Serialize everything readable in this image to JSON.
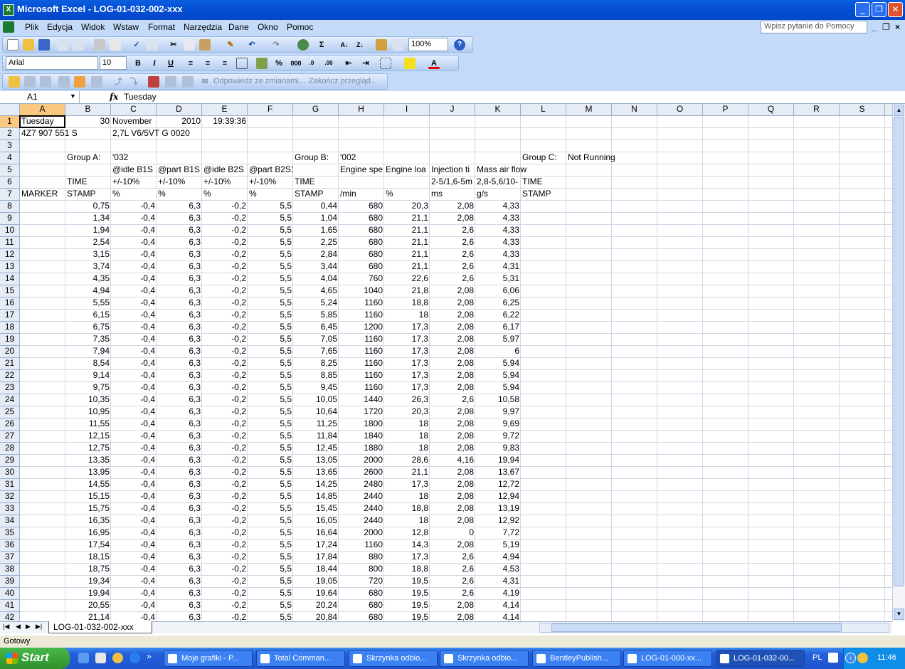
{
  "window": {
    "title": "Microsoft Excel - LOG-01-032-002-xxx",
    "app_icon": "excel-icon"
  },
  "menu": {
    "items": [
      "Plik",
      "Edycja",
      "Widok",
      "Wstaw",
      "Format",
      "Narzędzia",
      "Dane",
      "Okno",
      "Pomoc"
    ],
    "help_placeholder": "Wpisz pytanie do Pomocy"
  },
  "toolbar": {
    "zoom": "100%",
    "font": "Arial",
    "font_size": "10",
    "sigma": "Σ",
    "bold": "B",
    "italic": "I",
    "underline": "U",
    "percent": "%",
    "thousands": "000",
    "reply_label": "Odpowiedz ze zmianami...",
    "end_review_label": "Zakończ przegląd..."
  },
  "formula_bar": {
    "name_box": "A1",
    "fx": "fx",
    "content": "Tuesday"
  },
  "columns": [
    "A",
    "B",
    "C",
    "D",
    "E",
    "F",
    "G",
    "H",
    "I",
    "J",
    "K",
    "L",
    "M",
    "N",
    "O",
    "P",
    "Q",
    "R",
    "S"
  ],
  "header_cells": [
    {
      "r": 1,
      "c": 0,
      "v": "Tuesday"
    },
    {
      "r": 1,
      "c": 1,
      "v": "30",
      "n": true
    },
    {
      "r": 1,
      "c": 2,
      "v": "November"
    },
    {
      "r": 1,
      "c": 3,
      "v": "2010",
      "n": true
    },
    {
      "r": 1,
      "c": 4,
      "v": "19:39:36",
      "n": true
    },
    {
      "r": 2,
      "c": 0,
      "v": "4Z7 907 551 S"
    },
    {
      "r": 2,
      "c": 2,
      "v": "2,7L V6/5VT    G   0020"
    },
    {
      "r": 4,
      "c": 1,
      "v": "Group A:"
    },
    {
      "r": 4,
      "c": 2,
      "v": "'032"
    },
    {
      "r": 4,
      "c": 6,
      "v": "Group B:"
    },
    {
      "r": 4,
      "c": 7,
      "v": "'002"
    },
    {
      "r": 4,
      "c": 11,
      "v": "Group C:"
    },
    {
      "r": 4,
      "c": 12,
      "v": "Not Running"
    },
    {
      "r": 5,
      "c": 2,
      "v": "@idle B1S"
    },
    {
      "r": 5,
      "c": 3,
      "v": "@part B1S"
    },
    {
      "r": 5,
      "c": 4,
      "v": "@idle B2S"
    },
    {
      "r": 5,
      "c": 5,
      "v": "@part B2S1"
    },
    {
      "r": 5,
      "c": 7,
      "v": "Engine spe"
    },
    {
      "r": 5,
      "c": 8,
      "v": "Engine loa"
    },
    {
      "r": 5,
      "c": 9,
      "v": "Injection ti"
    },
    {
      "r": 5,
      "c": 10,
      "v": "Mass air flow"
    },
    {
      "r": 6,
      "c": 1,
      "v": "TIME"
    },
    {
      "r": 6,
      "c": 2,
      "v": "+/-10%"
    },
    {
      "r": 6,
      "c": 3,
      "v": "+/-10%"
    },
    {
      "r": 6,
      "c": 4,
      "v": "+/-10%"
    },
    {
      "r": 6,
      "c": 5,
      "v": "+/-10%"
    },
    {
      "r": 6,
      "c": 6,
      "v": "TIME"
    },
    {
      "r": 6,
      "c": 9,
      "v": "2-5/1,6-5m"
    },
    {
      "r": 6,
      "c": 10,
      "v": "2,8-5,6/10-"
    },
    {
      "r": 6,
      "c": 11,
      "v": "TIME"
    },
    {
      "r": 7,
      "c": 0,
      "v": "MARKER"
    },
    {
      "r": 7,
      "c": 1,
      "v": "STAMP"
    },
    {
      "r": 7,
      "c": 2,
      "v": "%"
    },
    {
      "r": 7,
      "c": 3,
      "v": "%"
    },
    {
      "r": 7,
      "c": 4,
      "v": "%"
    },
    {
      "r": 7,
      "c": 5,
      "v": "%"
    },
    {
      "r": 7,
      "c": 6,
      "v": "STAMP"
    },
    {
      "r": 7,
      "c": 7,
      "v": " /min"
    },
    {
      "r": 7,
      "c": 8,
      "v": "%"
    },
    {
      "r": 7,
      "c": 9,
      "v": " ms"
    },
    {
      "r": 7,
      "c": 10,
      "v": "g/s"
    },
    {
      "r": 7,
      "c": 11,
      "v": "STAMP"
    }
  ],
  "data_rows": [
    [
      "0,75",
      "-0,4",
      "6,3",
      "-0,2",
      "5,5",
      "0,44",
      "680",
      "20,3",
      "2,08",
      "4,33"
    ],
    [
      "1,34",
      "-0,4",
      "6,3",
      "-0,2",
      "5,5",
      "1,04",
      "680",
      "21,1",
      "2,08",
      "4,33"
    ],
    [
      "1,94",
      "-0,4",
      "6,3",
      "-0,2",
      "5,5",
      "1,65",
      "680",
      "21,1",
      "2,6",
      "4,33"
    ],
    [
      "2,54",
      "-0,4",
      "6,3",
      "-0,2",
      "5,5",
      "2,25",
      "680",
      "21,1",
      "2,6",
      "4,33"
    ],
    [
      "3,15",
      "-0,4",
      "6,3",
      "-0,2",
      "5,5",
      "2,84",
      "680",
      "21,1",
      "2,6",
      "4,33"
    ],
    [
      "3,74",
      "-0,4",
      "6,3",
      "-0,2",
      "5,5",
      "3,44",
      "680",
      "21,1",
      "2,6",
      "4,31"
    ],
    [
      "4,35",
      "-0,4",
      "6,3",
      "-0,2",
      "5,5",
      "4,04",
      "760",
      "22,6",
      "2,6",
      "5,31"
    ],
    [
      "4,94",
      "-0,4",
      "6,3",
      "-0,2",
      "5,5",
      "4,65",
      "1040",
      "21,8",
      "2,08",
      "6,06"
    ],
    [
      "5,55",
      "-0,4",
      "6,3",
      "-0,2",
      "5,5",
      "5,24",
      "1160",
      "18,8",
      "2,08",
      "6,25"
    ],
    [
      "6,15",
      "-0,4",
      "6,3",
      "-0,2",
      "5,5",
      "5,85",
      "1160",
      "18",
      "2,08",
      "6,22"
    ],
    [
      "6,75",
      "-0,4",
      "6,3",
      "-0,2",
      "5,5",
      "6,45",
      "1200",
      "17,3",
      "2,08",
      "6,17"
    ],
    [
      "7,35",
      "-0,4",
      "6,3",
      "-0,2",
      "5,5",
      "7,05",
      "1160",
      "17,3",
      "2,08",
      "5,97"
    ],
    [
      "7,94",
      "-0,4",
      "6,3",
      "-0,2",
      "5,5",
      "7,65",
      "1160",
      "17,3",
      "2,08",
      "6"
    ],
    [
      "8,54",
      "-0,4",
      "6,3",
      "-0,2",
      "5,5",
      "8,25",
      "1160",
      "17,3",
      "2,08",
      "5,94"
    ],
    [
      "9,14",
      "-0,4",
      "6,3",
      "-0,2",
      "5,5",
      "8,85",
      "1160",
      "17,3",
      "2,08",
      "5,94"
    ],
    [
      "9,75",
      "-0,4",
      "6,3",
      "-0,2",
      "5,5",
      "9,45",
      "1160",
      "17,3",
      "2,08",
      "5,94"
    ],
    [
      "10,35",
      "-0,4",
      "6,3",
      "-0,2",
      "5,5",
      "10,05",
      "1440",
      "26,3",
      "2,6",
      "10,58"
    ],
    [
      "10,95",
      "-0,4",
      "6,3",
      "-0,2",
      "5,5",
      "10,64",
      "1720",
      "20,3",
      "2,08",
      "9,97"
    ],
    [
      "11,55",
      "-0,4",
      "6,3",
      "-0,2",
      "5,5",
      "11,25",
      "1800",
      "18",
      "2,08",
      "9,69"
    ],
    [
      "12,15",
      "-0,4",
      "6,3",
      "-0,2",
      "5,5",
      "11,84",
      "1840",
      "18",
      "2,08",
      "9,72"
    ],
    [
      "12,75",
      "-0,4",
      "6,3",
      "-0,2",
      "5,5",
      "12,45",
      "1880",
      "18",
      "2,08",
      "9,83"
    ],
    [
      "13,35",
      "-0,4",
      "6,3",
      "-0,2",
      "5,5",
      "13,05",
      "2000",
      "28,6",
      "4,16",
      "19,94"
    ],
    [
      "13,95",
      "-0,4",
      "6,3",
      "-0,2",
      "5,5",
      "13,65",
      "2600",
      "21,1",
      "2,08",
      "13,67"
    ],
    [
      "14,55",
      "-0,4",
      "6,3",
      "-0,2",
      "5,5",
      "14,25",
      "2480",
      "17,3",
      "2,08",
      "12,72"
    ],
    [
      "15,15",
      "-0,4",
      "6,3",
      "-0,2",
      "5,5",
      "14,85",
      "2440",
      "18",
      "2,08",
      "12,94"
    ],
    [
      "15,75",
      "-0,4",
      "6,3",
      "-0,2",
      "5,5",
      "15,45",
      "2440",
      "18,8",
      "2,08",
      "13,19"
    ],
    [
      "16,35",
      "-0,4",
      "6,3",
      "-0,2",
      "5,5",
      "16,05",
      "2440",
      "18",
      "2,08",
      "12,92"
    ],
    [
      "16,95",
      "-0,4",
      "6,3",
      "-0,2",
      "5,5",
      "16,64",
      "2000",
      "12,8",
      "0",
      "7,72"
    ],
    [
      "17,54",
      "-0,4",
      "6,3",
      "-0,2",
      "5,5",
      "17,24",
      "1160",
      "14,3",
      "2,08",
      "5,19"
    ],
    [
      "18,15",
      "-0,4",
      "6,3",
      "-0,2",
      "5,5",
      "17,84",
      "880",
      "17,3",
      "2,6",
      "4,94"
    ],
    [
      "18,75",
      "-0,4",
      "6,3",
      "-0,2",
      "5,5",
      "18,44",
      "800",
      "18,8",
      "2,6",
      "4,53"
    ],
    [
      "19,34",
      "-0,4",
      "6,3",
      "-0,2",
      "5,5",
      "19,05",
      "720",
      "19,5",
      "2,6",
      "4,31"
    ],
    [
      "19,94",
      "-0,4",
      "6,3",
      "-0,2",
      "5,5",
      "19,64",
      "680",
      "19,5",
      "2,6",
      "4,19"
    ],
    [
      "20,55",
      "-0,4",
      "6,3",
      "-0,2",
      "5,5",
      "20,24",
      "680",
      "19,5",
      "2,08",
      "4,14"
    ],
    [
      "21,14",
      "-0,4",
      "6,3",
      "-0,2",
      "5,5",
      "20,84",
      "680",
      "19,5",
      "2,08",
      "4,14"
    ]
  ],
  "sheet_tab": "LOG-01-032-002-xxx",
  "status": "Gotowy",
  "taskbar": {
    "start": "Start",
    "tasks": [
      "Moje grafiki - P...",
      "Total Comman...",
      "Skrzynka odbio...",
      "Skrzynka odbio...",
      "BentleyPublish...",
      "LOG-01-000-xx...",
      "LOG-01-032-00..."
    ],
    "lang": "PL",
    "clock": "11:46"
  }
}
